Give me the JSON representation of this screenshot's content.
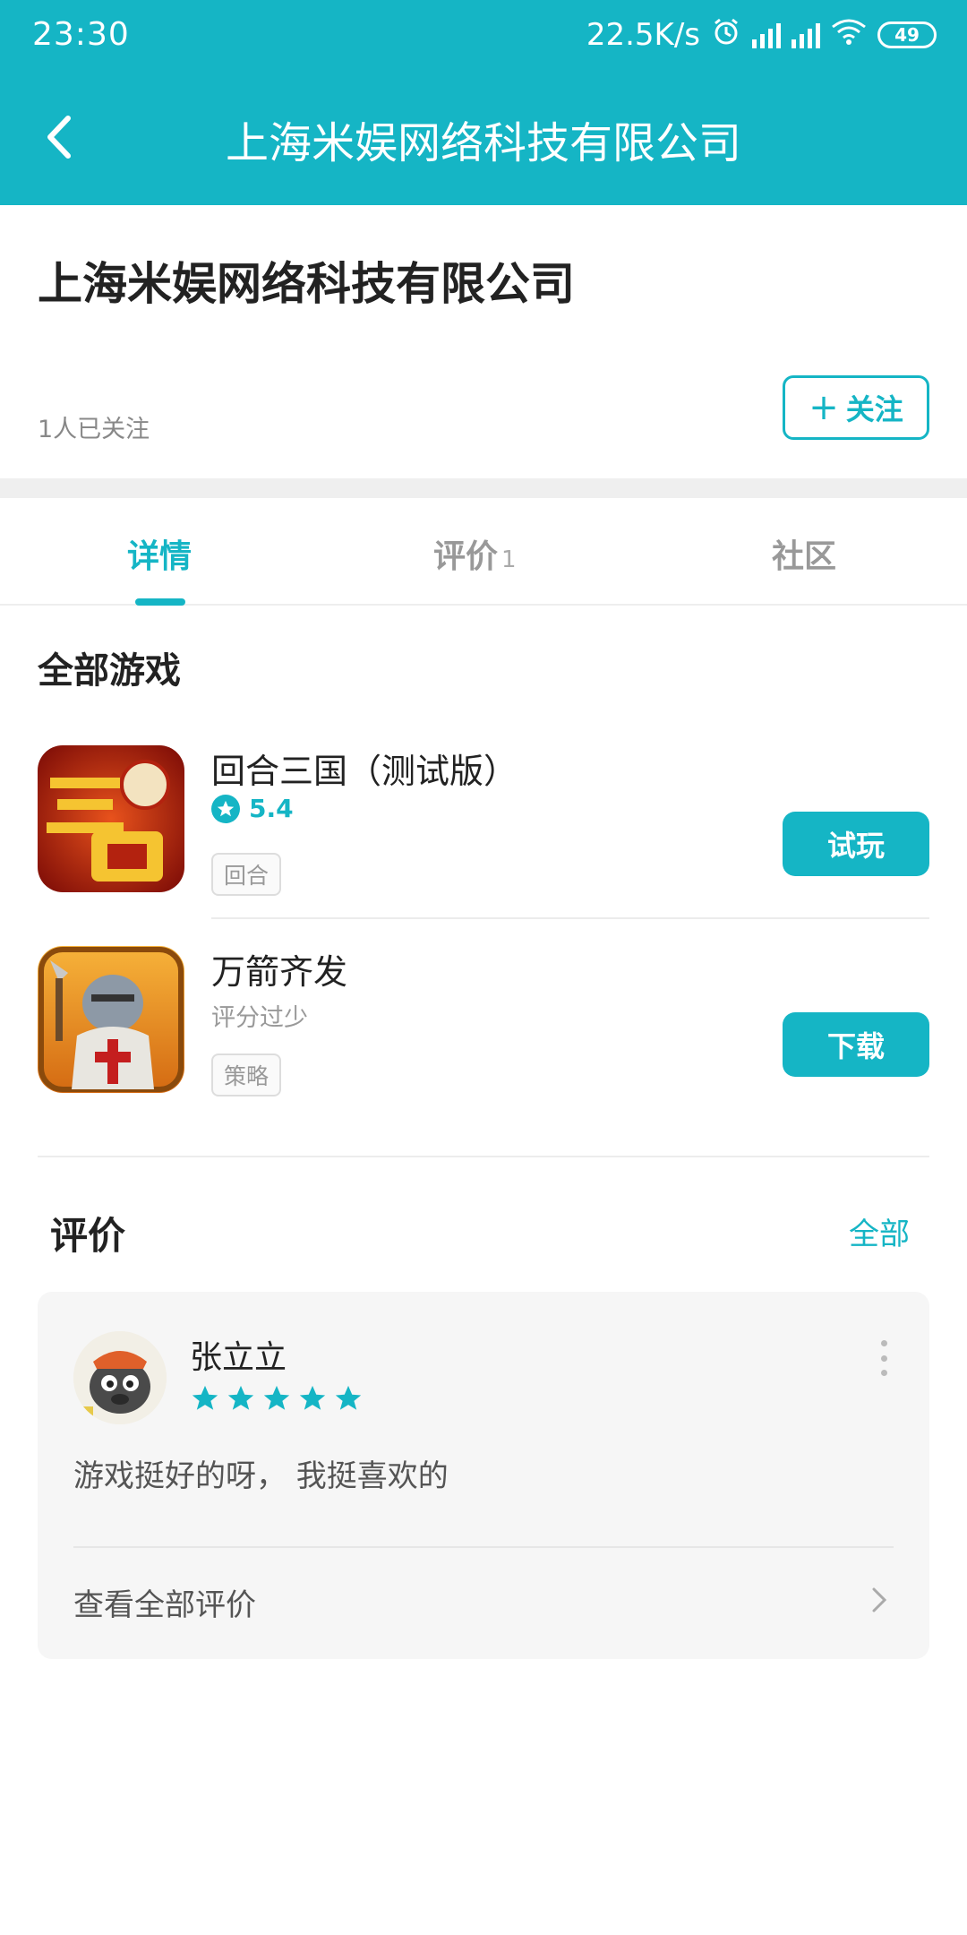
{
  "status_bar": {
    "time": "23:30",
    "network_speed": "22.5K/s",
    "battery": "49"
  },
  "header": {
    "title": "上海米娱网络科技有限公司"
  },
  "company": {
    "name": "上海米娱网络科技有限公司",
    "followers": "1人已关注",
    "follow_label": "关注"
  },
  "tabs": [
    {
      "label": "详情",
      "active": true
    },
    {
      "label": "评价",
      "count": "1"
    },
    {
      "label": "社区"
    }
  ],
  "games_section": {
    "title": "全部游戏",
    "games": [
      {
        "name": "回合三国（测试版）",
        "rating": "5.4",
        "tag": "回合",
        "action": "试玩",
        "icon": "game-icon-huihe-sanguo"
      },
      {
        "name": "万箭齐发",
        "rating_text": "评分过少",
        "tag": "策略",
        "action": "下载",
        "icon": "game-icon-wanjian-qifa"
      }
    ]
  },
  "reviews": {
    "title": "评价",
    "all_label": "全部",
    "items": [
      {
        "user": "张立立",
        "stars": 5,
        "text": "游戏挺好的呀， 我挺喜欢的"
      }
    ],
    "see_all": "查看全部评价"
  },
  "colors": {
    "accent": "#15b5c5",
    "text": "#222222",
    "muted": "#999999"
  }
}
